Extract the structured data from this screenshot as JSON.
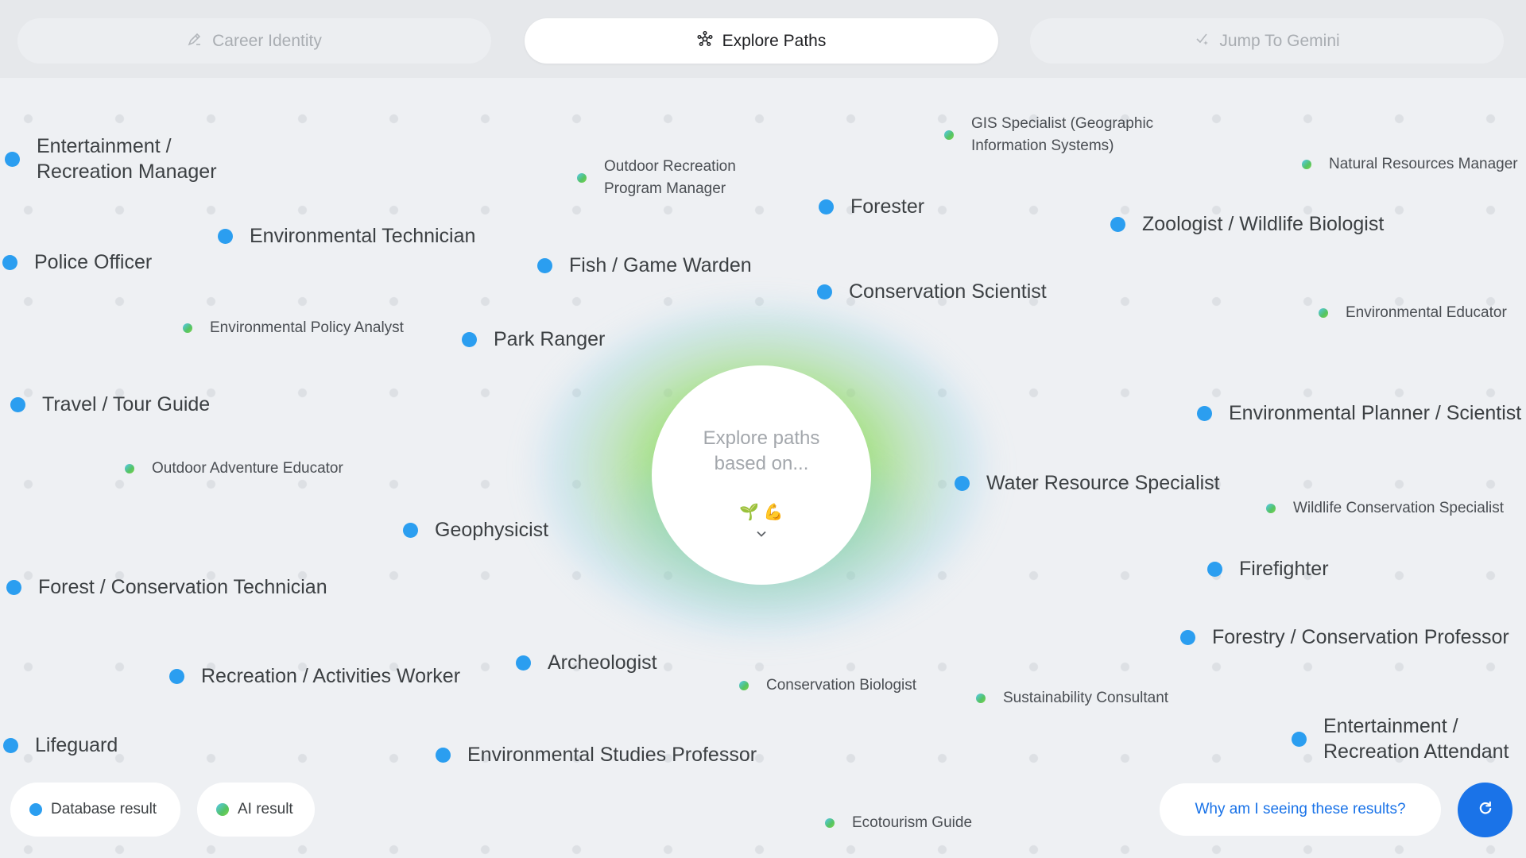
{
  "tabs": [
    {
      "label": "Career Identity",
      "icon": "pencil-icon",
      "active": false
    },
    {
      "label": "Explore Paths",
      "icon": "network-icon",
      "active": true
    },
    {
      "label": "Jump To Gemini",
      "icon": "sparkle-icon",
      "active": false
    }
  ],
  "center": {
    "text": "Explore paths based on...",
    "emoji": "🌱 💪",
    "icon": "chevron-down-icon"
  },
  "careers": [
    {
      "label": "Entertainment / Recreation Manager",
      "type": "database"
    },
    {
      "label": "Outdoor Recreation Program Manager",
      "type": "ai"
    },
    {
      "label": "GIS Specialist (Geographic Information Systems)",
      "type": "ai"
    },
    {
      "label": "Natural Resources Manager",
      "type": "ai"
    },
    {
      "label": "Forester",
      "type": "database"
    },
    {
      "label": "Zoologist / Wildlife Biologist",
      "type": "database"
    },
    {
      "label": "Environmental Technician",
      "type": "database"
    },
    {
      "label": "Police Officer",
      "type": "database"
    },
    {
      "label": "Fish / Game Warden",
      "type": "database"
    },
    {
      "label": "Conservation Scientist",
      "type": "database"
    },
    {
      "label": "Environmental Educator",
      "type": "ai"
    },
    {
      "label": "Environmental Policy Analyst",
      "type": "ai"
    },
    {
      "label": "Park Ranger",
      "type": "database"
    },
    {
      "label": "Travel / Tour Guide",
      "type": "database"
    },
    {
      "label": "Environmental Planner / Scientist",
      "type": "database"
    },
    {
      "label": "Outdoor Adventure Educator",
      "type": "ai"
    },
    {
      "label": "Water Resource Specialist",
      "type": "database"
    },
    {
      "label": "Wildlife Conservation Specialist",
      "type": "ai"
    },
    {
      "label": "Geophysicist",
      "type": "database"
    },
    {
      "label": "Firefighter",
      "type": "database"
    },
    {
      "label": "Forest / Conservation Technician",
      "type": "database"
    },
    {
      "label": "Forestry / Conservation Professor",
      "type": "database"
    },
    {
      "label": "Archeologist",
      "type": "database"
    },
    {
      "label": "Recreation / Activities Worker",
      "type": "database"
    },
    {
      "label": "Conservation Biologist",
      "type": "ai"
    },
    {
      "label": "Sustainability Consultant",
      "type": "ai"
    },
    {
      "label": "Entertainment / Recreation Attendant",
      "type": "database"
    },
    {
      "label": "Lifeguard",
      "type": "database"
    },
    {
      "label": "Environmental Studies Professor",
      "type": "database"
    },
    {
      "label": "Ecotourism Guide",
      "type": "ai"
    }
  ],
  "legend": {
    "database": "Database result",
    "ai": "AI result"
  },
  "why_button": "Why am I seeing these results?",
  "refresh_icon": "refresh-icon",
  "colors": {
    "database_dot": "#2b9ef0",
    "ai_dot_gradient": [
      "#56c7f2",
      "#54c464"
    ],
    "accent": "#1a73e8"
  }
}
